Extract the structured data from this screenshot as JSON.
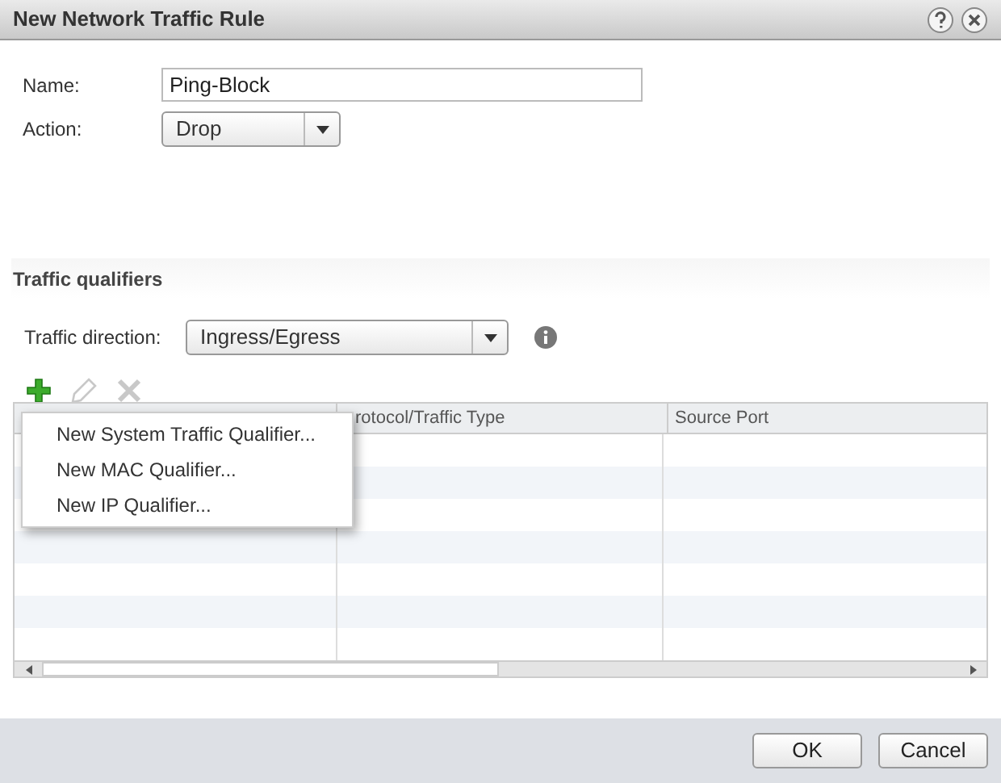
{
  "window": {
    "title": "New Network Traffic Rule"
  },
  "form": {
    "name_label": "Name:",
    "name_value": "Ping-Block",
    "action_label": "Action:",
    "action_value": "Drop"
  },
  "section": {
    "title": "Traffic qualifiers"
  },
  "direction": {
    "label": "Traffic direction:",
    "value": "Ingress/Egress"
  },
  "toolbar": [
    {
      "kind": "add",
      "disabled": false
    },
    {
      "kind": "edit",
      "disabled": true
    },
    {
      "kind": "remove",
      "disabled": true
    }
  ],
  "menu": [
    "New System Traffic Qualifier...",
    "New MAC Qualifier...",
    "New IP Qualifier..."
  ],
  "table": {
    "columns": [
      {
        "label": "rotocol/Traffic Type"
      },
      {
        "label": "Source Port"
      }
    ]
  },
  "buttons": [
    "OK",
    "Cancel"
  ]
}
